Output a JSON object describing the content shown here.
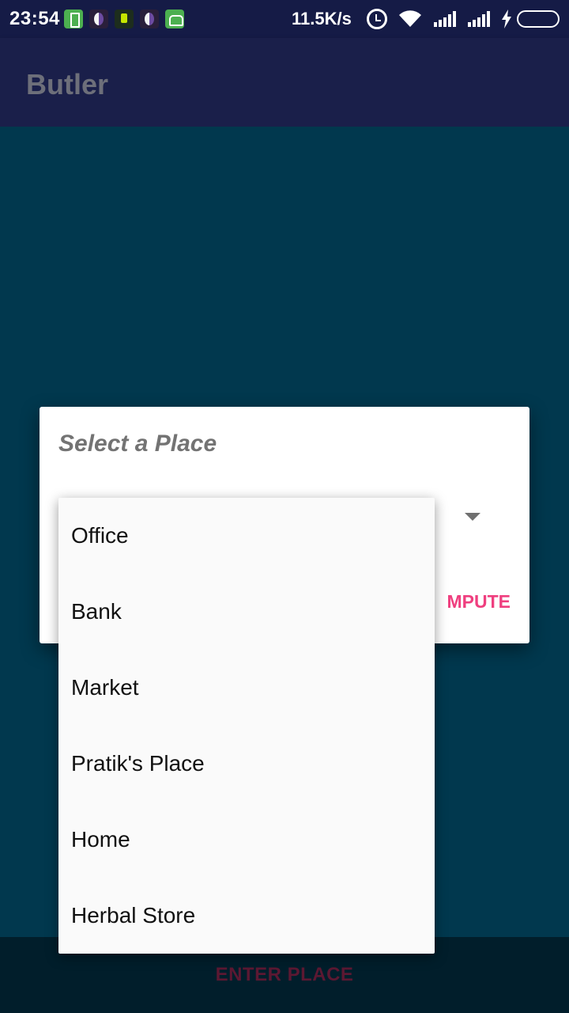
{
  "status_bar": {
    "time": "23:54",
    "net_speed": "11.5K/s",
    "notification_icons": [
      "battery-saver-icon",
      "moon-icon",
      "pin-icon",
      "moon-icon",
      "android-icon"
    ],
    "battery_level": 1.0,
    "colors": {
      "background": "#151b46",
      "battery": "#66d24a"
    }
  },
  "app_bar": {
    "title": "Butler",
    "colors": {
      "background": "#1a1f4a",
      "title": "#6d6f7a"
    }
  },
  "dialog": {
    "title": "Select a Place",
    "action_button_partial": "MPUTE",
    "colors": {
      "action": "#ef3f7f"
    }
  },
  "dropdown": {
    "items": [
      "Office",
      "Bank",
      "Market",
      "Pratik's Place",
      "Home",
      "Herbal Store"
    ]
  },
  "bottom_bar": {
    "button_label": "ENTER PLACE",
    "colors": {
      "background": "#011e2b",
      "label": "#5c1832"
    }
  },
  "background": {
    "color": "#01384e"
  }
}
